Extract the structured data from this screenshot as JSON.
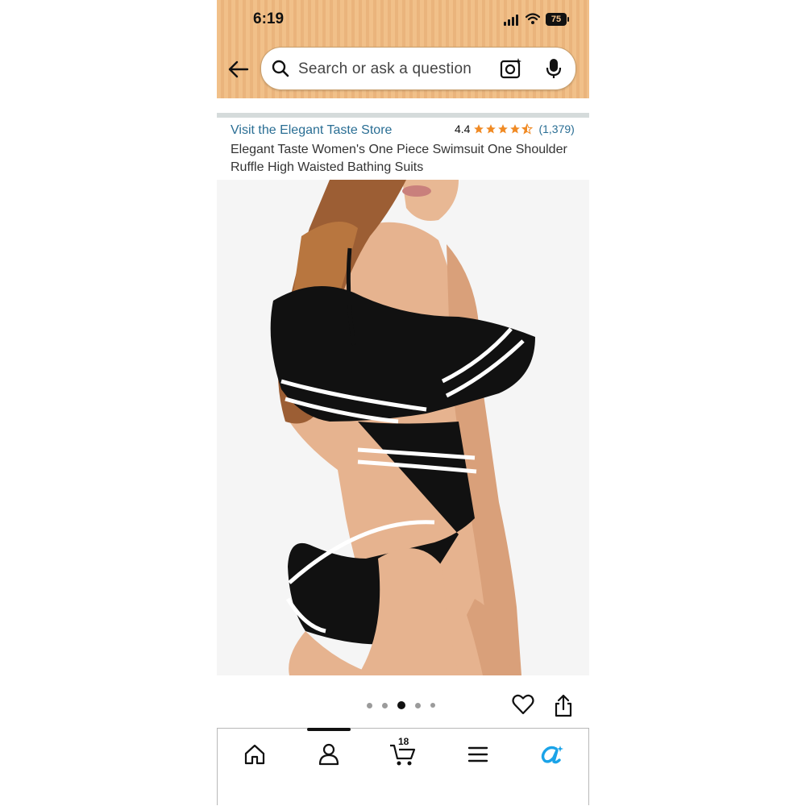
{
  "status_bar": {
    "time": "6:19",
    "battery": "75"
  },
  "search": {
    "placeholder": "Search or ask a question"
  },
  "product": {
    "store_link": "Visit the Elegant Taste Store",
    "rating_value": "4.4",
    "stars": 4.5,
    "review_count": "(1,379)",
    "title": "Elegant Taste Women's One Piece Swimsuit One Shoulder Ruffle High Waisted Bathing Suits"
  },
  "carousel": {
    "total": 5,
    "active_index": 2
  },
  "bottom_nav": {
    "items": [
      {
        "name": "home",
        "icon": "home-icon"
      },
      {
        "name": "account",
        "icon": "person-icon",
        "active": true
      },
      {
        "name": "cart",
        "icon": "cart-icon",
        "badge": "18"
      },
      {
        "name": "menu",
        "icon": "hamburger-icon"
      },
      {
        "name": "rufus",
        "icon": "rufus-ai-icon"
      }
    ]
  },
  "colors": {
    "header": "#f1c089",
    "link": "#2a6e94",
    "star": "#f08a24",
    "ai_accent": "#1aa3e8"
  }
}
